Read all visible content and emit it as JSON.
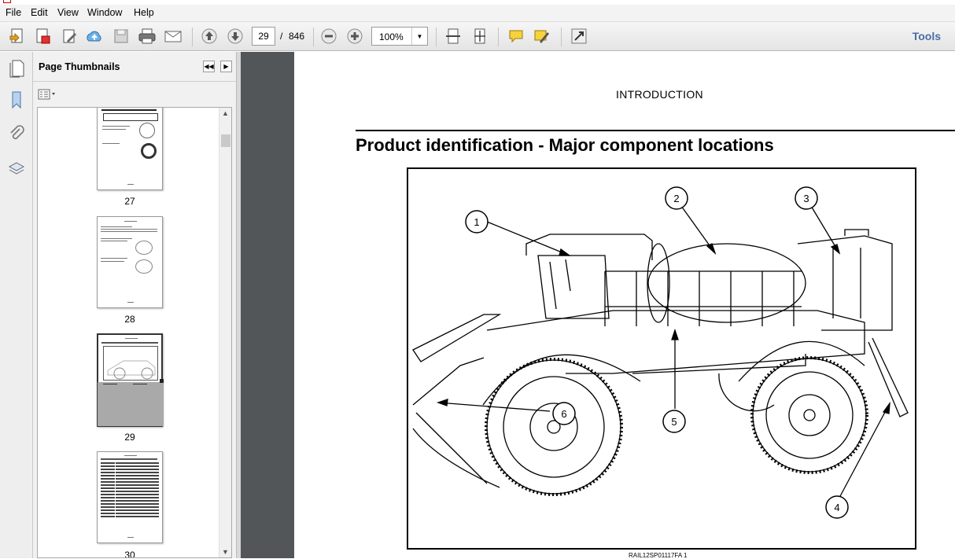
{
  "menu": [
    "File",
    "Edit",
    "View",
    "Window",
    "Help"
  ],
  "toolbar": {
    "current_page": "29",
    "page_separator": "/",
    "total_pages": "846",
    "zoom": "100%",
    "tools_label": "Tools"
  },
  "panel": {
    "title": "Page Thumbnails",
    "thumbnails": [
      "27",
      "28",
      "29",
      "30"
    ]
  },
  "document": {
    "header": "INTRODUCTION",
    "heading": "Product identification - Major component locations",
    "callouts": [
      "1",
      "2",
      "3",
      "4",
      "5",
      "6"
    ],
    "caption": "RAIL12SP01117FA     1"
  },
  "colors": {
    "doc_background": "#525659",
    "tools_accent": "#4a6da7"
  }
}
